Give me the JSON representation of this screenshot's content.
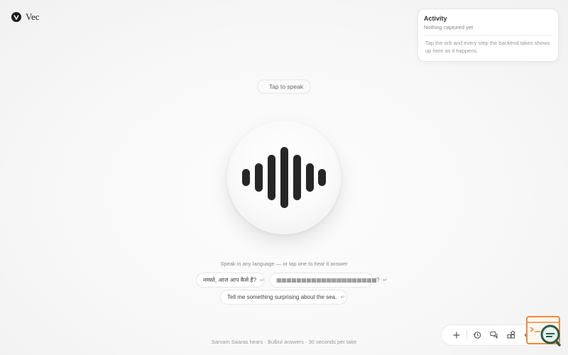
{
  "brand": {
    "name": "Vec",
    "logo_icon": "v-logo-icon"
  },
  "activity": {
    "title": "Activity",
    "status": "Nothing captured yet",
    "description": "Tap the orb and every step the backend takes shows up here as it happens."
  },
  "voice": {
    "tap_label": "Tap to speak",
    "orb_icon": "waveform-icon",
    "hint": "Speak in any language — or tap one to hear it answer"
  },
  "suggestions": [
    {
      "text": "नमस्ते, आज आप कैसे हैं?",
      "icon": "enter-icon"
    },
    {
      "text": "▦▦▦▦▦▦▦▦▦▦▦▦▦▦▦▦▦▦▦▦?",
      "icon": "enter-icon"
    },
    {
      "text": "Tell me something surprising about the sea.",
      "icon": "enter-icon"
    }
  ],
  "footer": {
    "text": "Sarvam Saaras hears · Bulbul answers · 30 seconds per take"
  },
  "toolbar": {
    "icons": [
      "plus-icon",
      "history-icon",
      "chat-icon",
      "apps-icon",
      "code-icon"
    ]
  },
  "colors": {
    "accent": "#1f1f1f",
    "dev_widget": "#f08a3a",
    "dev_widget_lens": "#2a5a4a"
  }
}
